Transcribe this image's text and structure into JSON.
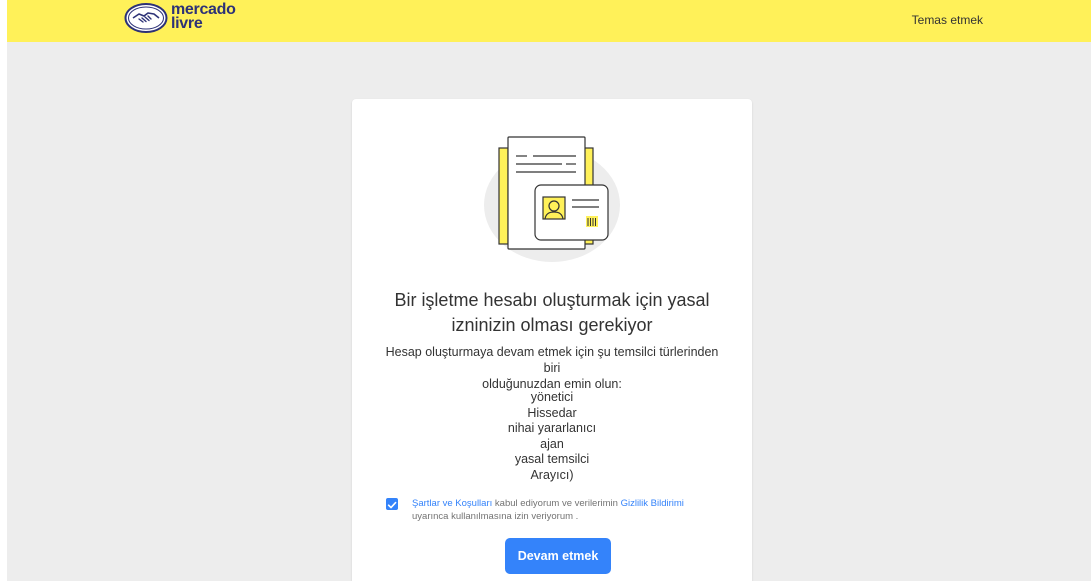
{
  "header": {
    "logo_line1": "mercado",
    "logo_line2": "livre",
    "contact_link": "Temas etmek"
  },
  "card": {
    "title_line1": "Bir işletme hesabı oluşturmak için yasal",
    "title_line2": "izninizin olması gerekiyor",
    "subtitle_line1": "Hesap oluşturmaya devam etmek için şu temsilci türlerinden biri",
    "subtitle_line2": "olduğunuzdan emin olun:",
    "roles": [
      "yönetici",
      "Hissedar",
      "nihai yararlanıcı",
      "ajan",
      "yasal temsilci",
      "Arayıcı)"
    ],
    "consent": {
      "checked": true,
      "terms_link": "Şartlar ve Koşulları",
      "text_middle": "kabul ediyorum ve verilerimin",
      "privacy_link": "Gizlilik Bildirimi",
      "text_end": "uyarınca kullanılmasına izin veriyorum ."
    },
    "continue_button": "Devam etmek"
  },
  "colors": {
    "header_bg": "#fff159",
    "page_bg": "#ededed",
    "primary": "#3483fa",
    "logo_text": "#2d3277"
  }
}
